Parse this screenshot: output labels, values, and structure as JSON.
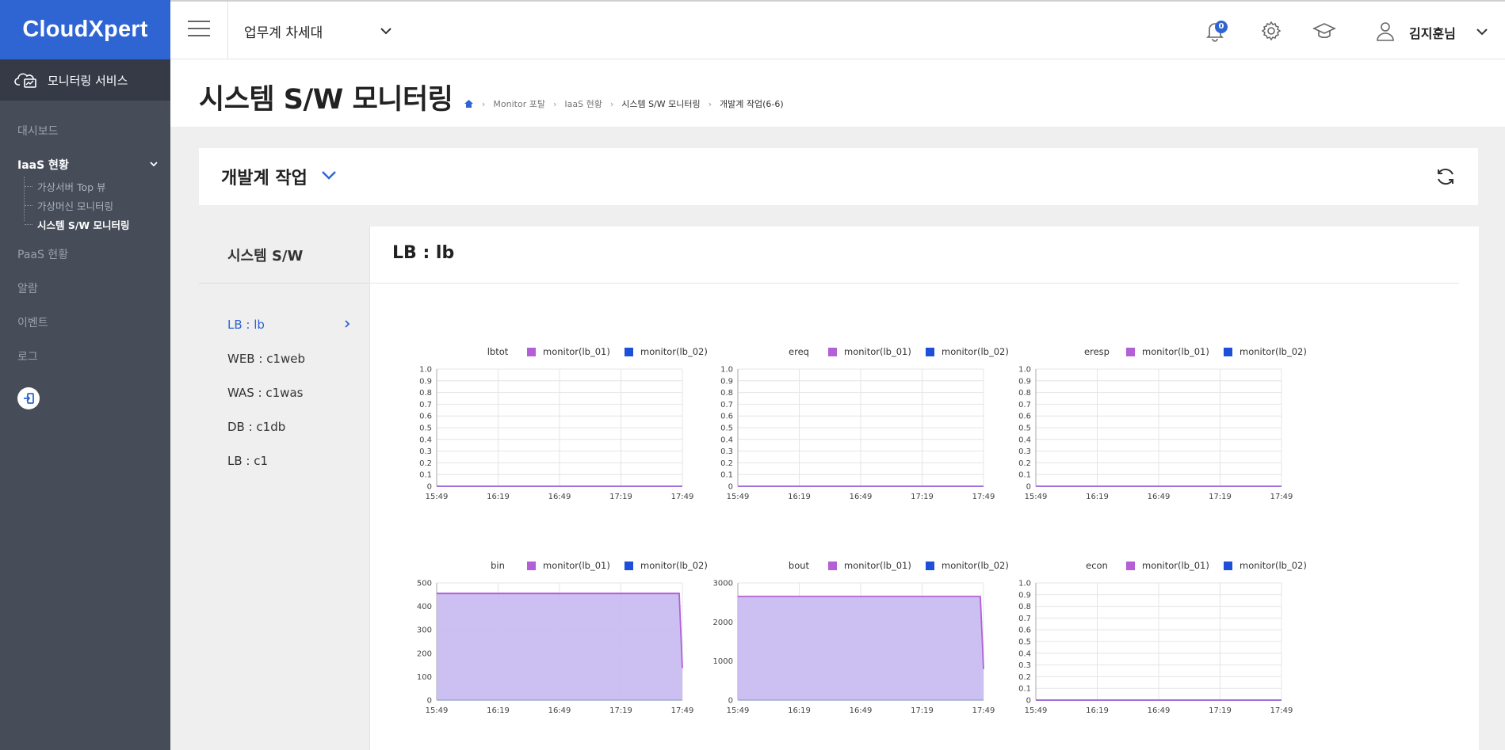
{
  "brand": {
    "logo_text": "CloudXpert"
  },
  "sidebar": {
    "service_label": "모니터링 서비스",
    "items": [
      {
        "label": "대시보드"
      },
      {
        "label": "IaaS 현황",
        "expanded": true,
        "children": [
          {
            "label": "가상서버 Top 뷰"
          },
          {
            "label": "가상머신 모니터링"
          },
          {
            "label": "시스템 S/W 모니터링",
            "active": true
          }
        ]
      },
      {
        "label": "PaaS 현황"
      },
      {
        "label": "알람"
      },
      {
        "label": "이벤트"
      },
      {
        "label": "로그"
      }
    ]
  },
  "topbar": {
    "workspace": "업무계 차세대",
    "notification_count": "0",
    "user_name": "김지훈님",
    "icons": [
      "menu-icon",
      "bell-icon",
      "gear-icon",
      "graduation-cap-icon",
      "user-icon"
    ]
  },
  "page": {
    "title": "시스템 S/W 모니터링",
    "breadcrumbs": [
      "Monitor 포탈",
      "IaaS 현황",
      "시스템 S/W 모니터링",
      "개발계 작업(6-6)"
    ]
  },
  "group": {
    "title": "개발계 작업"
  },
  "left_panel": {
    "title": "시스템 S/W",
    "items": [
      {
        "label": "LB : lb",
        "active": true
      },
      {
        "label": "WEB : c1web"
      },
      {
        "label": "WAS : c1was"
      },
      {
        "label": "DB : c1db"
      },
      {
        "label": "LB : c1"
      }
    ]
  },
  "main_panel": {
    "title": "LB : lb"
  },
  "colors": {
    "accent": "#2f64d3",
    "series1": "#b35fd6",
    "series2": "#1e4fd8",
    "area_fill": "#c5b9f0"
  },
  "chart_data": [
    {
      "type": "area",
      "title": "lbtot",
      "x": [
        "15:49",
        "16:19",
        "16:49",
        "17:19",
        "17:49"
      ],
      "series": [
        {
          "name": "monitor(lb_01)",
          "values": [
            0,
            0,
            0,
            0,
            0
          ]
        },
        {
          "name": "monitor(lb_02)",
          "values": [
            0,
            0,
            0,
            0,
            0
          ]
        }
      ],
      "ylim": [
        0,
        1.0
      ],
      "yticks": [
        "0",
        "0.1",
        "0.2",
        "0.3",
        "0.4",
        "0.5",
        "0.6",
        "0.7",
        "0.8",
        "0.9",
        "1.0"
      ],
      "grid": true,
      "legend": "top"
    },
    {
      "type": "area",
      "title": "ereq",
      "x": [
        "15:49",
        "16:19",
        "16:49",
        "17:19",
        "17:49"
      ],
      "series": [
        {
          "name": "monitor(lb_01)",
          "values": [
            0,
            0,
            0,
            0,
            0
          ]
        },
        {
          "name": "monitor(lb_02)",
          "values": [
            0,
            0,
            0,
            0,
            0
          ]
        }
      ],
      "ylim": [
        0,
        1.0
      ],
      "yticks": [
        "0",
        "0.1",
        "0.2",
        "0.3",
        "0.4",
        "0.5",
        "0.6",
        "0.7",
        "0.8",
        "0.9",
        "1.0"
      ],
      "grid": true,
      "legend": "top"
    },
    {
      "type": "area",
      "title": "eresp",
      "x": [
        "15:49",
        "16:19",
        "16:49",
        "17:19",
        "17:49"
      ],
      "series": [
        {
          "name": "monitor(lb_01)",
          "values": [
            0,
            0,
            0,
            0,
            0
          ]
        },
        {
          "name": "monitor(lb_02)",
          "values": [
            0,
            0,
            0,
            0,
            0
          ]
        }
      ],
      "ylim": [
        0,
        1.0
      ],
      "yticks": [
        "0",
        "0.1",
        "0.2",
        "0.3",
        "0.4",
        "0.5",
        "0.6",
        "0.7",
        "0.8",
        "0.9",
        "1.0"
      ],
      "grid": true,
      "legend": "top"
    },
    {
      "type": "area",
      "title": "bin",
      "x": [
        "15:49",
        "16:19",
        "16:49",
        "17:19",
        "17:49"
      ],
      "series": [
        {
          "name": "monitor(lb_01)",
          "values": [
            455,
            455,
            455,
            455,
            455
          ]
        },
        {
          "name": "monitor(lb_02)",
          "values": [
            0,
            0,
            0,
            0,
            0
          ]
        }
      ],
      "ylim": [
        0,
        500
      ],
      "yticks": [
        "0",
        "100",
        "200",
        "300",
        "400",
        "500"
      ],
      "grid": true,
      "legend": "top"
    },
    {
      "type": "area",
      "title": "bout",
      "x": [
        "15:49",
        "16:19",
        "16:49",
        "17:19",
        "17:49"
      ],
      "series": [
        {
          "name": "monitor(lb_01)",
          "values": [
            2650,
            2650,
            2650,
            2650,
            2650
          ]
        },
        {
          "name": "monitor(lb_02)",
          "values": [
            0,
            0,
            0,
            0,
            0
          ]
        }
      ],
      "ylim": [
        0,
        3000
      ],
      "yticks": [
        "0",
        "1000",
        "2000",
        "3000"
      ],
      "grid": true,
      "legend": "top"
    },
    {
      "type": "area",
      "title": "econ",
      "x": [
        "15:49",
        "16:19",
        "16:49",
        "17:19",
        "17:49"
      ],
      "series": [
        {
          "name": "monitor(lb_01)",
          "values": [
            0,
            0,
            0,
            0,
            0
          ]
        },
        {
          "name": "monitor(lb_02)",
          "values": [
            0,
            0,
            0,
            0,
            0
          ]
        }
      ],
      "ylim": [
        0,
        1.0
      ],
      "yticks": [
        "0",
        "0.1",
        "0.2",
        "0.3",
        "0.4",
        "0.5",
        "0.6",
        "0.7",
        "0.8",
        "0.9",
        "1.0"
      ],
      "grid": true,
      "legend": "top"
    }
  ]
}
